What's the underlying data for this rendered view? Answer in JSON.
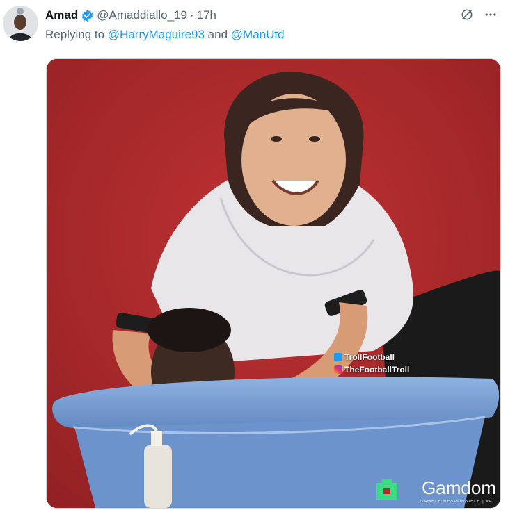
{
  "tweet": {
    "author": {
      "display_name": "Amad",
      "handle": "@Amaddiallo_19",
      "verified": true
    },
    "separator": "·",
    "time": "17h",
    "replying_prefix": "Replying to",
    "replying_to": [
      "@HarryMaguire93",
      "@ManUtd"
    ],
    "replying_joiner": "and"
  },
  "media": {
    "watermark": {
      "twitter": "TrollFootball",
      "instagram": "TheFootballTroll"
    },
    "ad": {
      "brand": "Gamdom",
      "tagline": "GAMBLE RESPONSIBLE | #AD"
    }
  },
  "icons": {
    "verified": "verified-badge-icon",
    "grok": "grok-icon",
    "more": "more-icon"
  },
  "colors": {
    "accent": "#1d9bf0",
    "secondary_text": "#536471",
    "background_wall": "#b52a2c",
    "tub": "#7ea3d6",
    "ad_logo": "#3ddc84"
  }
}
